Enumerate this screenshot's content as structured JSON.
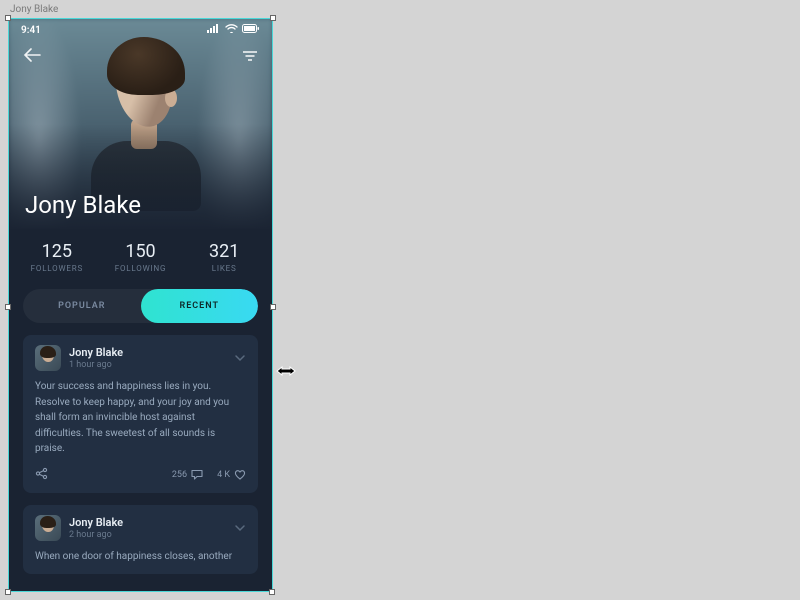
{
  "canvas": {
    "artboard_label": "Jony Blake"
  },
  "status": {
    "time": "9:41"
  },
  "profile": {
    "name": "Jony Blake",
    "stats": [
      {
        "value": "125",
        "label": "FOLLOWERS"
      },
      {
        "value": "150",
        "label": "FOLLOWING"
      },
      {
        "value": "321",
        "label": "LIKES"
      }
    ]
  },
  "tabs": {
    "popular": "POPULAR",
    "recent": "RECENT"
  },
  "posts": [
    {
      "author": "Jony Blake",
      "time": "1 hour ago",
      "body": "Your success and happiness lies in you. Resolve to keep happy, and your joy and you shall form an invincible host against difficulties. The sweetest of all sounds is praise.",
      "comments": "256",
      "likes": "4 K"
    },
    {
      "author": "Jony Blake",
      "time": "2 hour ago",
      "body": "When one door of happiness closes, another"
    }
  ]
}
